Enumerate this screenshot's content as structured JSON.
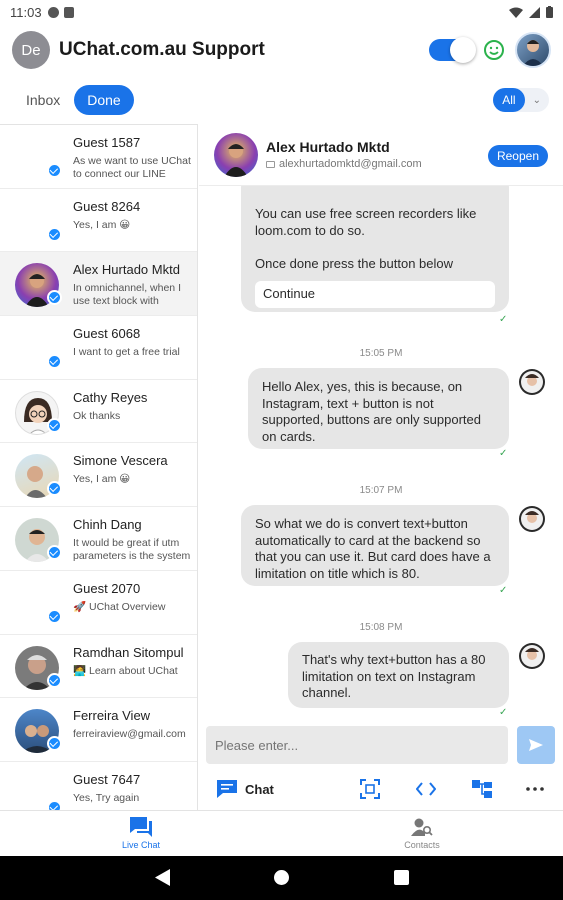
{
  "status": {
    "time": "11:03"
  },
  "header": {
    "avatar_initials": "De",
    "title": "UChat.com.au Support"
  },
  "filters": {
    "inbox_label": "Inbox",
    "done_label": "Done",
    "scope_label": "All"
  },
  "conversations": [
    {
      "name": "Guest 1587",
      "preview": "As we want to use UChat to connect our LINE account"
    },
    {
      "name": "Guest 8264",
      "preview": "Yes, I am 😀"
    },
    {
      "name": "Alex Hurtado Mktd",
      "preview": "In omnichannel, when I use text block with buttons, it"
    },
    {
      "name": "Guest 6068",
      "preview": "I want to get a free trial"
    },
    {
      "name": "Cathy Reyes",
      "preview": "Ok thanks"
    },
    {
      "name": "Simone Vescera",
      "preview": "Yes, I am 😀"
    },
    {
      "name": "Chinh Dang",
      "preview": "It would be great if utm parameters is the system"
    },
    {
      "name": "Guest 2070",
      "preview": "🚀 UChat Overview"
    },
    {
      "name": "Ramdhan Sitompul",
      "preview": "🧑‍💻 Learn about UChat"
    },
    {
      "name": "Ferreira View",
      "preview": "ferreiraview@gmail.com"
    },
    {
      "name": "Guest 7647",
      "preview": "Yes, Try again"
    }
  ],
  "chat": {
    "contact_name": "Alex Hurtado Mktd",
    "contact_email": "alexhurtadomktd@gmail.com",
    "reopen_label": "Reopen",
    "first_bubble_line1": "You can use free screen recorders like loom.com to do so.",
    "first_bubble_line2": "Once done press the button below",
    "continue_label": "Continue",
    "messages": [
      {
        "time": "15:05 PM",
        "text": "Hello Alex, yes, this is because, on Instagram, text + button is not supported, buttons are only supported on cards."
      },
      {
        "time": "15:07 PM",
        "text": "So what we do is convert text+button automatically to card at the backend so that you can use it. But card does have a limitation on title which is 80."
      },
      {
        "time": "15:08 PM",
        "text": "That's why text+button has a 80 limitation on text on Instagram channel."
      }
    ],
    "input_placeholder": "Please enter...",
    "chat_tool_label": "Chat"
  },
  "bottom_nav": {
    "live_chat_label": "Live Chat",
    "contacts_label": "Contacts"
  },
  "colors": {
    "accent": "#1a73e8",
    "bubble": "#e6e6e6",
    "messenger": "#1a8cff"
  }
}
